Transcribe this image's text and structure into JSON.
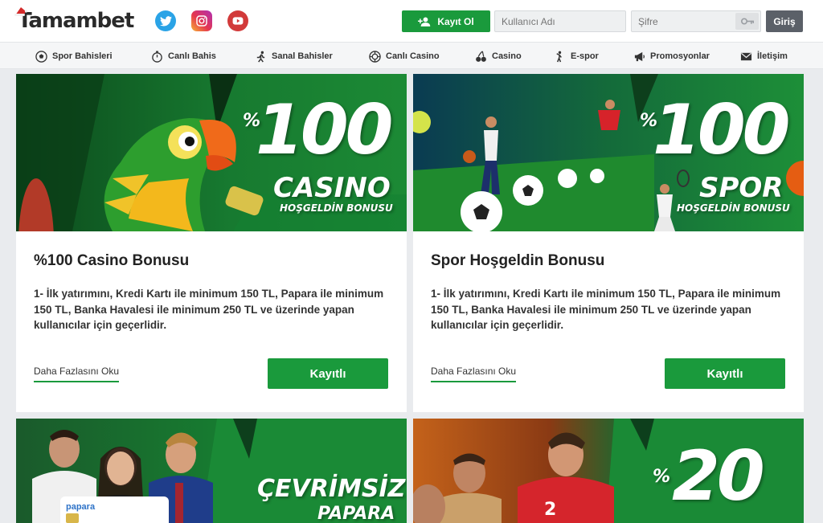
{
  "header": {
    "logo": "Tamambet",
    "register_label": "Kayıt Ol",
    "username_placeholder": "Kullanıcı Adı",
    "password_placeholder": "Şifre",
    "login_label": "Giriş",
    "social": [
      "twitter-icon",
      "instagram-icon",
      "youtube-icon"
    ]
  },
  "nav": {
    "items": [
      {
        "label": "Spor Bahisleri",
        "icon": "soccer-ball-icon"
      },
      {
        "label": "Canlı Bahis",
        "icon": "stopwatch-icon"
      },
      {
        "label": "Sanal Bahisler",
        "icon": "runner-icon"
      },
      {
        "label": "Canlı Casino",
        "icon": "casino-chip-icon"
      },
      {
        "label": "Casino",
        "icon": "cherries-icon"
      },
      {
        "label": "E-spor",
        "icon": "player-icon"
      },
      {
        "label": "Promosyonlar",
        "icon": "megaphone-icon"
      },
      {
        "label": "İletişim",
        "icon": "envelope-icon"
      }
    ]
  },
  "cards": [
    {
      "banner": {
        "percent": "%",
        "big": "100",
        "line1": "CASINO",
        "line2": "HOŞGELDİN BONUSU"
      },
      "title": "%100 Casino Bonusu",
      "desc": "1- İlk yatırımını, Kredi Kartı ile minimum 150 TL, Papara ile minimum 150 TL, Banka Havalesi ile minimum 250 TL ve üzerinde yapan kullanıcılar için geçerlidir.",
      "read_more": "Daha Fazlasını Oku",
      "button": "Kayıtlı"
    },
    {
      "banner": {
        "percent": "%",
        "big": "100",
        "line1": "SPOR",
        "line2": "HOŞGELDİN BONUSU"
      },
      "title": "Spor Hoşgeldin Bonusu",
      "desc": "1- İlk yatırımını, Kredi Kartı ile minimum 150 TL, Papara ile minimum 150 TL, Banka Havalesi ile minimum 250 TL ve üzerinde yapan kullanıcılar için geçerlidir.",
      "read_more": "Daha Fazlasını Oku",
      "button": "Kayıtlı"
    },
    {
      "banner": {
        "line1": "ÇEVRİMSİZ",
        "line2": "PAPARA",
        "card_brand": "papara"
      }
    },
    {
      "banner": {
        "percent": "%",
        "big": "20",
        "jersey_number": "2"
      }
    }
  ],
  "colors": {
    "brand_green": "#1a9a3c",
    "login_gray": "#5b6068"
  }
}
